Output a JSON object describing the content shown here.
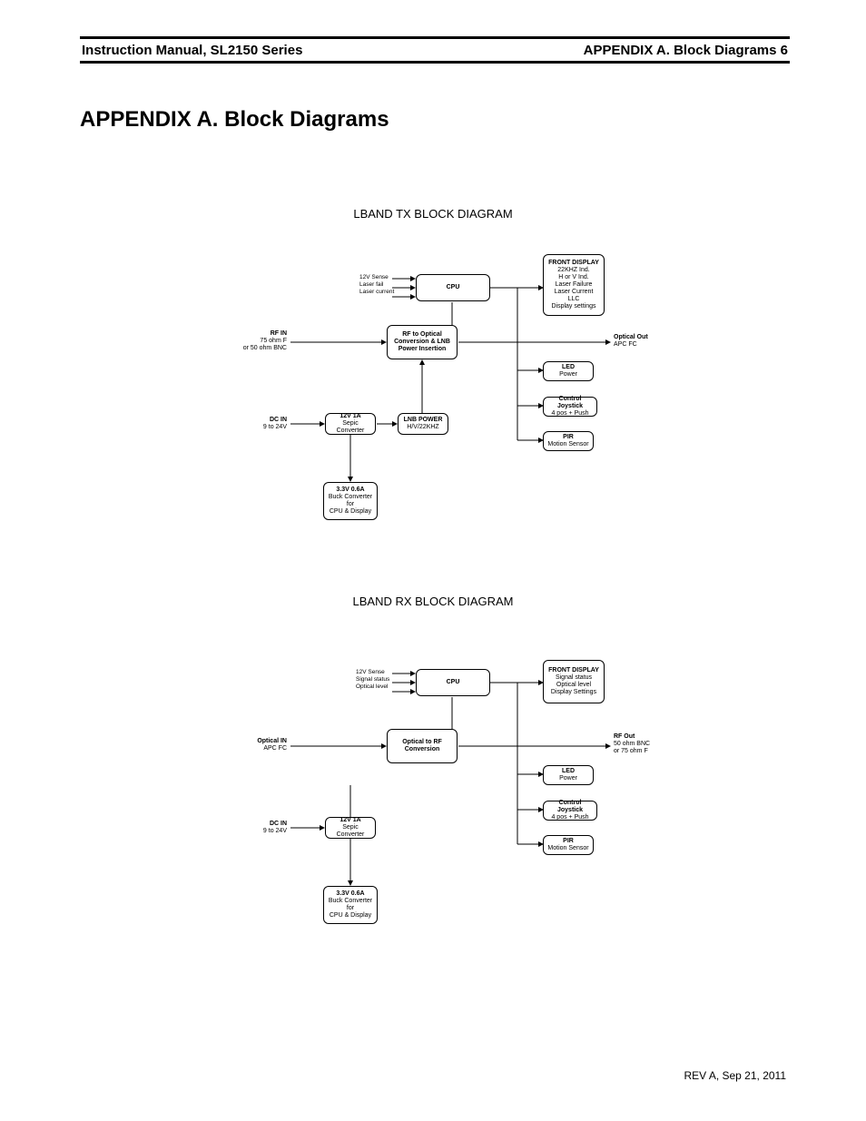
{
  "header": {
    "left": "Instruction Manual, SL2150 Series",
    "right": "APPENDIX A. Block Diagrams 6"
  },
  "appendix_title": "APPENDIX A. Block Diagrams",
  "footer": "REV A, Sep 21, 2011",
  "tx": {
    "title": "LBAND TX BLOCK DIAGRAM",
    "cpu": "CPU",
    "cpu_inputs": [
      "12V Sense",
      "Laser fail",
      "Laser current"
    ],
    "rf_opt": {
      "l1": "RF to Optical",
      "l2": "Conversion & LNB",
      "l3": "Power Insertion"
    },
    "sepic": {
      "l1": "12V 1A",
      "l2": "Sepic Converter"
    },
    "lnb": {
      "l1": "LNB POWER",
      "l2": "H/V/22KHZ"
    },
    "buck": {
      "l1": "3.3V 0.6A",
      "l2": "Buck Converter",
      "l3": "for",
      "l4": "CPU & Display"
    },
    "front": {
      "t": "FRONT DISPLAY",
      "a": "22KHZ Ind.",
      "b": "H or V Ind.",
      "c": "Laser Failure",
      "d": "Laser Current",
      "e": "LLC",
      "f": "Display settings"
    },
    "led": {
      "l1": "LED",
      "l2": "Power"
    },
    "joy": {
      "l1": "Control Joystick",
      "l2": "4 pos + Push"
    },
    "pir": {
      "l1": "PIR",
      "l2": "Motion Sensor"
    },
    "io": {
      "rf_in": {
        "t": "RF IN",
        "a": "75 ohm F",
        "b": "or 50 ohm BNC"
      },
      "dc_in": {
        "t": "DC IN",
        "a": "9 to 24V"
      },
      "opt_out": {
        "t": "Optical Out",
        "a": "APC FC"
      }
    }
  },
  "rx": {
    "title": "LBAND RX BLOCK DIAGRAM",
    "cpu": "CPU",
    "cpu_inputs": [
      "12V Sense",
      "Signal status",
      "Optical level"
    ],
    "opt_rf": {
      "l1": "Optical to RF",
      "l2": "Conversion"
    },
    "sepic": {
      "l1": "12V 1A",
      "l2": "Sepic Converter"
    },
    "buck": {
      "l1": "3.3V 0.6A",
      "l2": "Buck Converter",
      "l3": "for",
      "l4": "CPU & Display"
    },
    "front": {
      "t": "FRONT DISPLAY",
      "a": "Signal status",
      "b": "Optical level",
      "c": "Display Settings"
    },
    "led": {
      "l1": "LED",
      "l2": "Power"
    },
    "joy": {
      "l1": "Control Joystick",
      "l2": "4 pos + Push"
    },
    "pir": {
      "l1": "PIR",
      "l2": "Motion Sensor"
    },
    "io": {
      "opt_in": {
        "t": "Optical IN",
        "a": "APC FC"
      },
      "dc_in": {
        "t": "DC IN",
        "a": "9 to 24V"
      },
      "rf_out": {
        "t": "RF Out",
        "a": "50 ohm BNC",
        "b": "or 75 ohm F"
      }
    }
  }
}
